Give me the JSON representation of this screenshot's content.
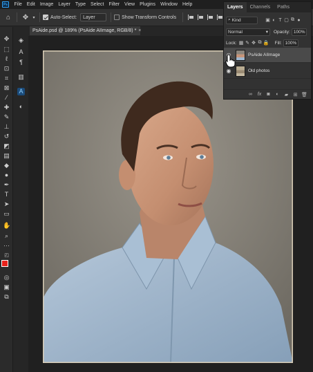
{
  "app": {
    "logo": "Ps"
  },
  "menu": [
    "File",
    "Edit",
    "Image",
    "Layer",
    "Type",
    "Select",
    "Filter",
    "View",
    "Plugins",
    "Window",
    "Help"
  ],
  "options": {
    "auto_select_label": "Auto-Select:",
    "auto_select_checked": true,
    "auto_select_target": "Layer",
    "show_transform_label": "Show Transform Controls",
    "show_transform_checked": false
  },
  "document": {
    "tab_title": "PsAide.psd @ 189% (PsAide AIImage, RGB/8) *",
    "close": "×"
  },
  "layers_panel": {
    "tabs": [
      "Layers",
      "Channels",
      "Paths"
    ],
    "active_tab": "Layers",
    "filter_label": "Kind",
    "blend_mode": "Normal",
    "opacity_label": "Opacity:",
    "opacity_value": "100%",
    "lock_label": "Lock:",
    "fill_label": "Fill:",
    "fill_value": "100%",
    "layers": [
      {
        "name": "PsAide AIImage",
        "selected": true,
        "visible": true
      },
      {
        "name": "Old photos",
        "selected": false,
        "visible": true
      }
    ]
  },
  "colors": {
    "foreground": "#e8221b",
    "background": "#ffffff",
    "accent": "#31a8ff",
    "shirt": "#9fb7cf",
    "backdrop": "#8a857c"
  },
  "icons": {
    "toolbar": [
      "move-icon",
      "marquee-icon",
      "lasso-icon",
      "object-select-icon",
      "crop-icon",
      "frame-icon",
      "eyedropper-icon",
      "healing-brush-icon",
      "brush-icon",
      "clone-stamp-icon",
      "history-brush-icon",
      "eraser-icon",
      "gradient-icon",
      "blur-icon",
      "dodge-icon",
      "pen-icon",
      "type-icon",
      "path-select-icon",
      "rectangle-icon",
      "hand-icon",
      "zoom-icon",
      "more-icon"
    ]
  }
}
